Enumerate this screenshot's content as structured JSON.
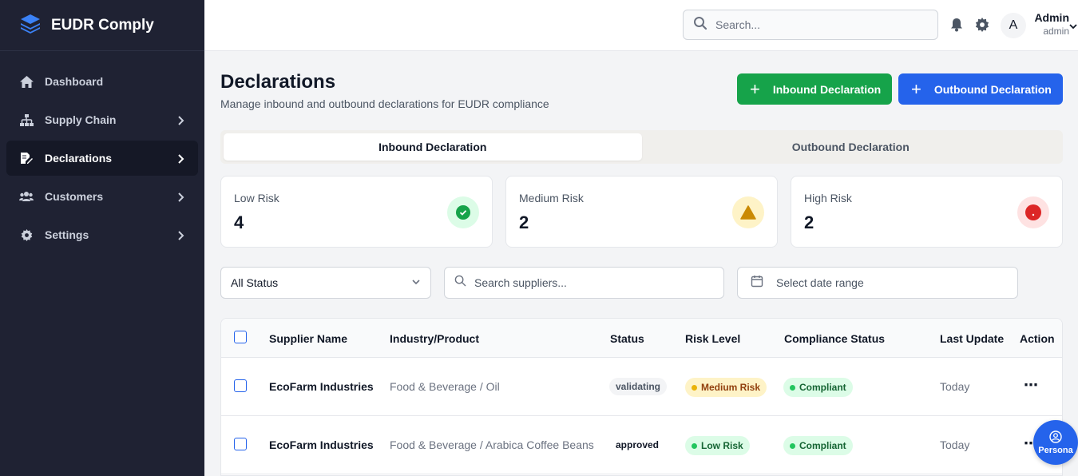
{
  "app": {
    "name": "EUDR Comply"
  },
  "sidebar": {
    "items": [
      {
        "label": "Dashboard",
        "icon": "home-icon",
        "has_chevron": false,
        "active": false
      },
      {
        "label": "Supply Chain",
        "icon": "sitemap-icon",
        "has_chevron": true,
        "active": false
      },
      {
        "label": "Declarations",
        "icon": "document-edit-icon",
        "has_chevron": true,
        "active": true
      },
      {
        "label": "Customers",
        "icon": "users-icon",
        "has_chevron": true,
        "active": false
      },
      {
        "label": "Settings",
        "icon": "gear-icon",
        "has_chevron": true,
        "active": false
      }
    ]
  },
  "header": {
    "search_placeholder": "Search...",
    "user": {
      "initial": "A",
      "name": "Admin",
      "role": "admin"
    }
  },
  "page": {
    "title": "Declarations",
    "subtitle": "Manage inbound and outbound declarations for EUDR compliance",
    "buttons": {
      "inbound": "Inbound Declaration",
      "outbound": "Outbound Declaration"
    }
  },
  "tabs": [
    {
      "label": "Inbound Declaration",
      "active": true
    },
    {
      "label": "Outbound Declaration",
      "active": false
    }
  ],
  "stats": [
    {
      "label": "Low Risk",
      "value": "4",
      "icon": "check-circle-icon",
      "color": "#16a34a",
      "bg": "#dcfce7"
    },
    {
      "label": "Medium Risk",
      "value": "2",
      "icon": "warning-triangle-icon",
      "color": "#ca8a04",
      "bg": "#fef3c7"
    },
    {
      "label": "High Risk",
      "value": "2",
      "icon": "alert-circle-icon",
      "color": "#dc2626",
      "bg": "#fee2e2"
    }
  ],
  "filters": {
    "status_value": "All Status",
    "search_placeholder": "Search suppliers...",
    "date_placeholder": "Select date range"
  },
  "table": {
    "columns": [
      "Supplier Name",
      "Industry/Product",
      "Status",
      "Risk Level",
      "Compliance Status",
      "Last Update",
      "Action"
    ],
    "rows": [
      {
        "supplier": "EcoFarm Industries",
        "industry": "Food & Beverage / Oil",
        "status": "validating",
        "risk": "Medium Risk",
        "compliance": "Compliant",
        "updated": "Today"
      },
      {
        "supplier": "EcoFarm Industries",
        "industry": "Food & Beverage / Arabica Coffee Beans",
        "status": "approved",
        "risk": "Low Risk",
        "compliance": "Compliant",
        "updated": "Today"
      }
    ]
  },
  "persona_label": "Persona",
  "colors": {
    "sidebar_bg": "#1f2233",
    "green": "#16a34a",
    "blue": "#2563eb"
  }
}
